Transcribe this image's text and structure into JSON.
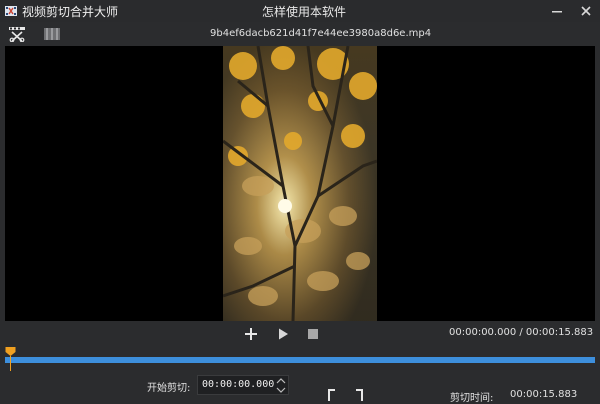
{
  "window": {
    "app_title": "视频剪切合并大师",
    "help_link": "怎样使用本软件"
  },
  "toolbar": {
    "file_name": "9b4ef6dacb621d41f7e44ee3980a8d6e.mp4"
  },
  "player": {
    "time_display": "00:00:00.000 / 00:00:15.883"
  },
  "timeline": {
    "position_fraction": 0
  },
  "trim": {
    "start_label": "开始剪切:",
    "start_value": "00:00:00.000",
    "cut_time_label": "剪切时间:",
    "cut_time_value": "00:00:15.883"
  },
  "colors": {
    "accent": "#3d8fdc",
    "playhead": "#f0a020",
    "background": "#2b2c2e"
  },
  "icons": {
    "app": "film-scissors-icon",
    "minimize": "minimize-icon",
    "close": "close-icon",
    "cut_tool": "cut-tool-icon",
    "film_tool": "film-strip-icon",
    "add": "plus-icon",
    "play": "play-icon",
    "stop": "stop-icon"
  }
}
